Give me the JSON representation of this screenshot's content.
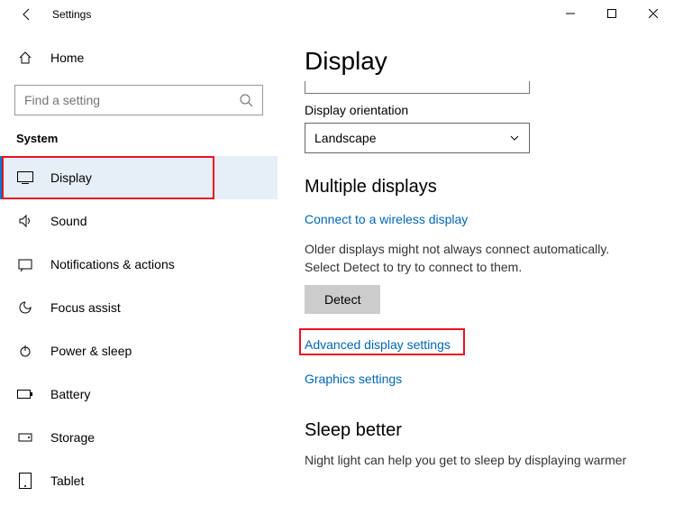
{
  "window": {
    "title": "Settings"
  },
  "sidebar": {
    "home": "Home",
    "search_placeholder": "Find a setting",
    "category": "System",
    "items": [
      {
        "label": "Display"
      },
      {
        "label": "Sound"
      },
      {
        "label": "Notifications & actions"
      },
      {
        "label": "Focus assist"
      },
      {
        "label": "Power & sleep"
      },
      {
        "label": "Battery"
      },
      {
        "label": "Storage"
      },
      {
        "label": "Tablet"
      }
    ]
  },
  "main": {
    "page_title": "Display",
    "orientation_label": "Display orientation",
    "orientation_value": "Landscape",
    "multiple_displays_heading": "Multiple displays",
    "wireless_link": "Connect to a wireless display",
    "detect_desc": "Older displays might not always connect automatically. Select Detect to try to connect to them.",
    "detect_btn": "Detect",
    "advanced_link": "Advanced display settings",
    "graphics_link": "Graphics settings",
    "sleep_heading": "Sleep better",
    "sleep_desc": "Night light can help you get to sleep by displaying warmer"
  }
}
